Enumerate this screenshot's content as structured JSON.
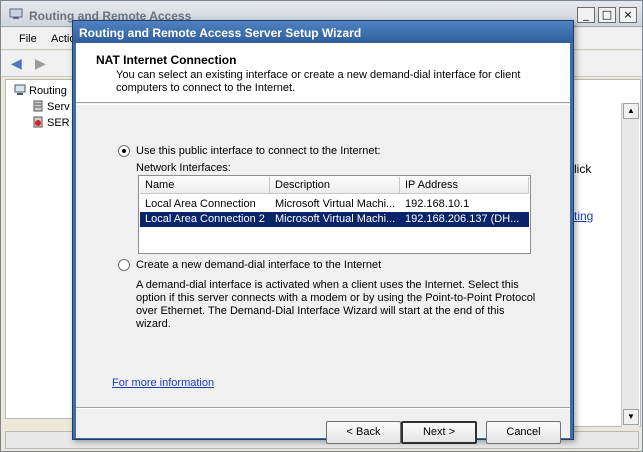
{
  "background_window": {
    "title": "Routing and Remote Access",
    "controls": {
      "minimize": "_",
      "maximize": "□",
      "close": "×"
    },
    "menu": {
      "file": "File",
      "action": "Actio"
    },
    "tree": {
      "root": "Routing",
      "server": "Serv",
      "ser": "SER"
    },
    "right_pane": {
      "text1": "lick",
      "text2": "ting"
    }
  },
  "wizard": {
    "title": "Routing and Remote Access Server Setup Wizard",
    "header": {
      "title": "NAT Internet Connection",
      "description": "You can select an existing interface or create a new demand-dial interface for client computers to connect to the Internet."
    },
    "option_public": {
      "label": "Use this public interface to connect to the Internet:",
      "selected": true
    },
    "network_interfaces_label": "Network Interfaces:",
    "columns": {
      "name": "Name",
      "description": "Description",
      "ip": "IP Address"
    },
    "rows": [
      {
        "name": "Local Area Connection",
        "description": "Microsoft Virtual Machi...",
        "ip": "192.168.10.1",
        "selected": false
      },
      {
        "name": "Local Area Connection 2",
        "description": "Microsoft Virtual Machi...",
        "ip": "192.168.206.137 (DH...",
        "selected": true
      }
    ],
    "option_demand": {
      "label": "Create a new demand-dial interface to the Internet",
      "selected": false,
      "description": "A demand-dial interface is activated when a client uses the Internet. Select this option if this server connects with a modem or by using the Point-to-Point Protocol over Ethernet. The Demand-Dial Interface Wizard will start at the end of this wizard."
    },
    "more_info": "For more information",
    "buttons": {
      "back": "< Back",
      "next": "Next >",
      "cancel": "Cancel"
    }
  }
}
